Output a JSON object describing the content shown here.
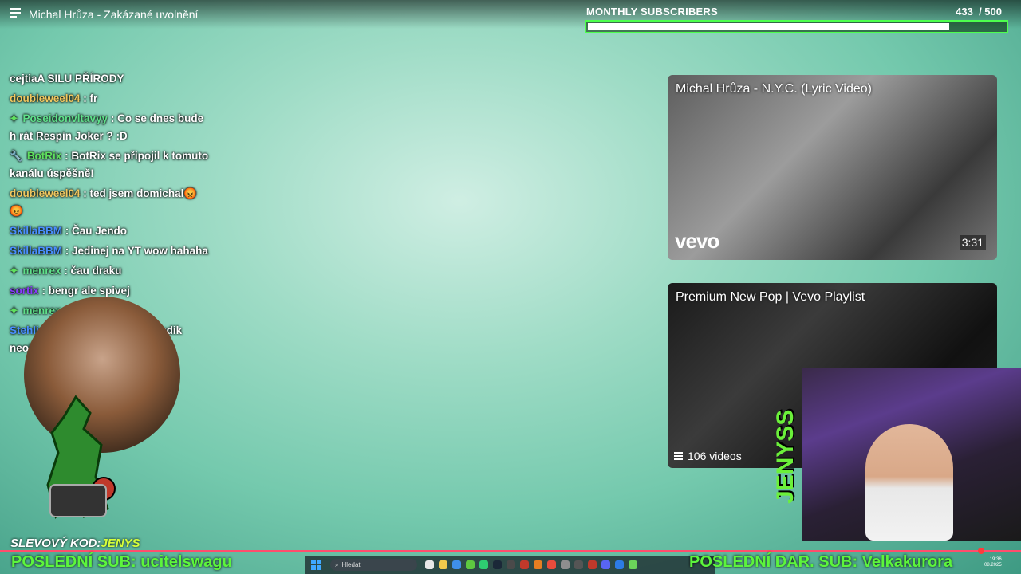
{
  "player": {
    "title": "Michal Hrůza - Zakázané uvolnění"
  },
  "goal": {
    "label": "MONTHLY SUBSCRIBERS",
    "current": "433",
    "target": "/ 500",
    "progress": 0.866
  },
  "chat": [
    {
      "user": "",
      "message": "cejtiaA SILU PŘÍRODY",
      "user_color": "#ffffff",
      "badge": ""
    },
    {
      "user": "doubleweel04",
      "message": ": fr",
      "user_color": "#f0c860",
      "badge": ""
    },
    {
      "user": "Poseidonvltavyy",
      "message": ": Co se dnes bude h rát Respin Joker ? :D",
      "user_color": "#5fe08a",
      "badge": "green-gem-icon"
    },
    {
      "user": "BotRix",
      "message": ": BotRix se připojil k tomuto kanálu úspěšně!",
      "user_color": "#5fe05f",
      "badge": "wrench-icon"
    },
    {
      "user": "doubleweel04",
      "message": ": ted jsem domichal😡😡",
      "user_color": "#f0c860",
      "badge": ""
    },
    {
      "user": "SkillaBBM",
      "message": ": Čau Jendo",
      "user_color": "#4a8fff",
      "badge": ""
    },
    {
      "user": "SkillaBBM",
      "message": ": Jedinej na YT wow hahaha",
      "user_color": "#4a8fff",
      "badge": ""
    },
    {
      "user": "menrex",
      "message": ": čau draku",
      "user_color": "#5fe08a",
      "badge": "green-gem-icon"
    },
    {
      "user": "sortix",
      "message": ": bengr ale spivej",
      "user_color": "#8a3cff",
      "badge": ""
    },
    {
      "user": "menrex",
      "message": ": 🐱",
      "user_color": "#5fe08a",
      "badge": "green-gem-icon"
    },
    {
      "user": "Stehlicek",
      "message": ": nevis proc uz se budik neobjevuje na clashi?",
      "user_color": "#4a8fff",
      "badge": ""
    }
  ],
  "promo": {
    "label": "SLEVOVÝ KOD:",
    "code": "JENYS"
  },
  "cards": [
    {
      "title": "Michal Hrůza - N.Y.C. (Lyric Video)",
      "logo": "vevo",
      "duration": "3:31"
    },
    {
      "title": "Premium New Pop | Vevo Playlist",
      "logo": "vevo",
      "video_count": "106 videos"
    }
  ],
  "webcam": {
    "tag": "JENYSS"
  },
  "ticker": {
    "last_sub": "POSLEDNÍ SUB: ucitelswagu",
    "last_gift": "POSLEDNÍ DAR. SUB: Velkakurora"
  },
  "taskbar": {
    "search_placeholder": "Hledat",
    "time": "19:36",
    "date": "08.2025"
  },
  "colors": {
    "goal_border": "#4dff4d",
    "ticker_text": "#5cf53c",
    "promo_code": "#d6ff3a"
  }
}
